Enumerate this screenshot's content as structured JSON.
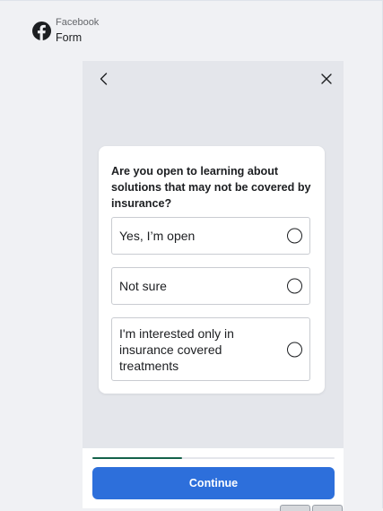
{
  "ad_header": {
    "platform": "Facebook",
    "format": "Form"
  },
  "form": {
    "question": "Are you open to learning about solutions that may not be covered by insurance?",
    "options": [
      {
        "label": "Yes, I’m open",
        "selected": false
      },
      {
        "label": "Not sure",
        "selected": false
      },
      {
        "label": "I'm interested only in insurance covered treatments",
        "selected": false
      }
    ],
    "progress": 0.37,
    "continue_label": "Continue"
  },
  "icons": {
    "logo": "facebook-logo-icon",
    "back": "chevron-left-icon",
    "close": "close-icon",
    "option": "radio-icon"
  },
  "colors": {
    "brand": "#1c1e21",
    "button": "#2d6fdb",
    "progress": "#13624a",
    "background": "#e4e6eb"
  }
}
